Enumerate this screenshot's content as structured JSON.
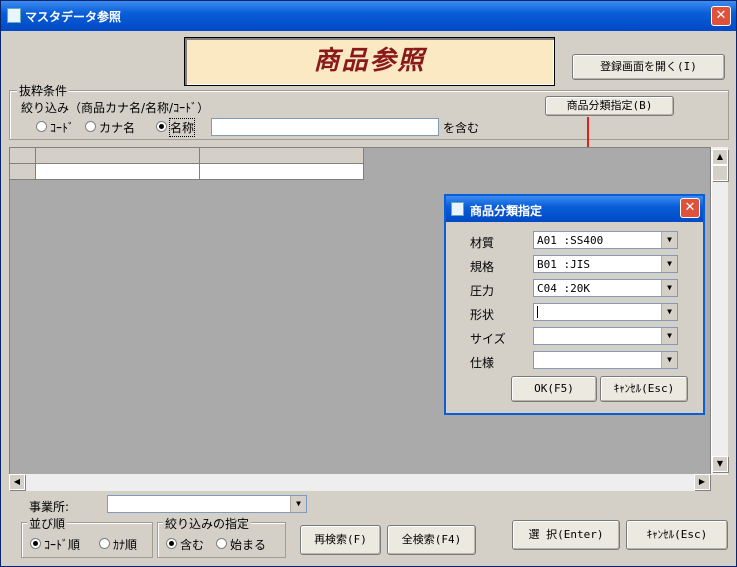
{
  "window": {
    "title": "マスタデータ参照",
    "close_glyph": "✕"
  },
  "banner": {
    "text": "商品参照"
  },
  "buttons": {
    "open_register": "登録画面を開く(I)",
    "category_spec": "商品分類指定(B)",
    "research": "再検索(F)",
    "search_all": "全検索(F4)",
    "select": "選 択(Enter)",
    "cancel": "ｷｬﾝｾﾙ(Esc)"
  },
  "filter": {
    "group_title": "抜粋条件",
    "narrow_label": "絞り込み（商品カナ名/名称/ｺｰﾄﾞ）",
    "options": [
      "ｺｰﾄﾞ",
      "カナ名",
      "名称"
    ],
    "selected": "名称",
    "contains_suffix": "を含む",
    "input_value": ""
  },
  "office": {
    "label": "事業所:",
    "value": ""
  },
  "sort": {
    "group_title": "並び順",
    "options": [
      "ｺｰﾄﾞ順",
      "ｶﾅ順"
    ],
    "selected": "ｺｰﾄﾞ順"
  },
  "match": {
    "group_title": "絞り込みの指定",
    "options": [
      "含む",
      "始まる"
    ],
    "selected": "含む"
  },
  "dialog": {
    "title": "商品分類指定",
    "close_glyph": "✕",
    "fields": [
      {
        "label": "材質",
        "value": "A01 :SS400"
      },
      {
        "label": "規格",
        "value": "B01 :JIS"
      },
      {
        "label": "圧力",
        "value": "C04 :20K"
      },
      {
        "label": "形状",
        "value": ""
      },
      {
        "label": "サイズ",
        "value": ""
      },
      {
        "label": "仕様",
        "value": ""
      }
    ],
    "ok": "OK(F5)",
    "cancel": "ｷｬﾝｾﾙ(Esc)"
  },
  "colors": {
    "title_bar": "#0a5ed8",
    "banner_bg": "#fbe9c4",
    "banner_text": "#8a1a1a",
    "arrow": "#e02020"
  },
  "icons": {
    "window": "app-icon",
    "dropdown": "chevron-down-icon"
  }
}
